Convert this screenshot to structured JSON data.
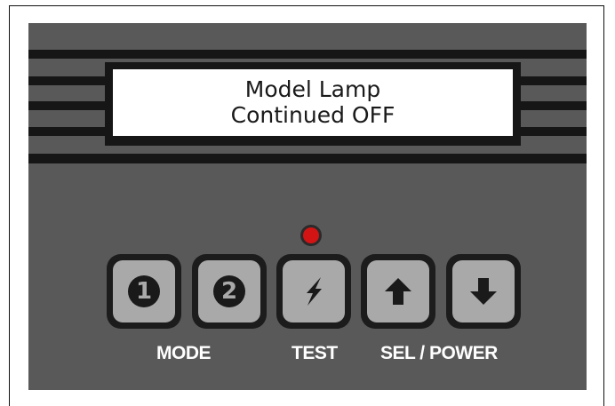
{
  "display": {
    "line1": "Model Lamp",
    "line2": "Continued OFF"
  },
  "indicator": {
    "color": "#d21414",
    "icon": "red-led"
  },
  "buttons": [
    {
      "id": "mode-1",
      "label": "1",
      "icon": "digit-one-circle"
    },
    {
      "id": "mode-2",
      "label": "2",
      "icon": "digit-two-circle"
    },
    {
      "id": "test",
      "label": "",
      "icon": "lightning-bolt-icon"
    },
    {
      "id": "up",
      "label": "",
      "icon": "arrow-up-icon"
    },
    {
      "id": "down",
      "label": "",
      "icon": "arrow-down-icon"
    }
  ],
  "labels": {
    "mode": "MODE",
    "test": "TEST",
    "sel_power": "SEL / POWER"
  },
  "colors": {
    "panel": "#595959",
    "button_face": "#a9a9a9",
    "dark": "#161616",
    "label_text": "#ffffff"
  }
}
